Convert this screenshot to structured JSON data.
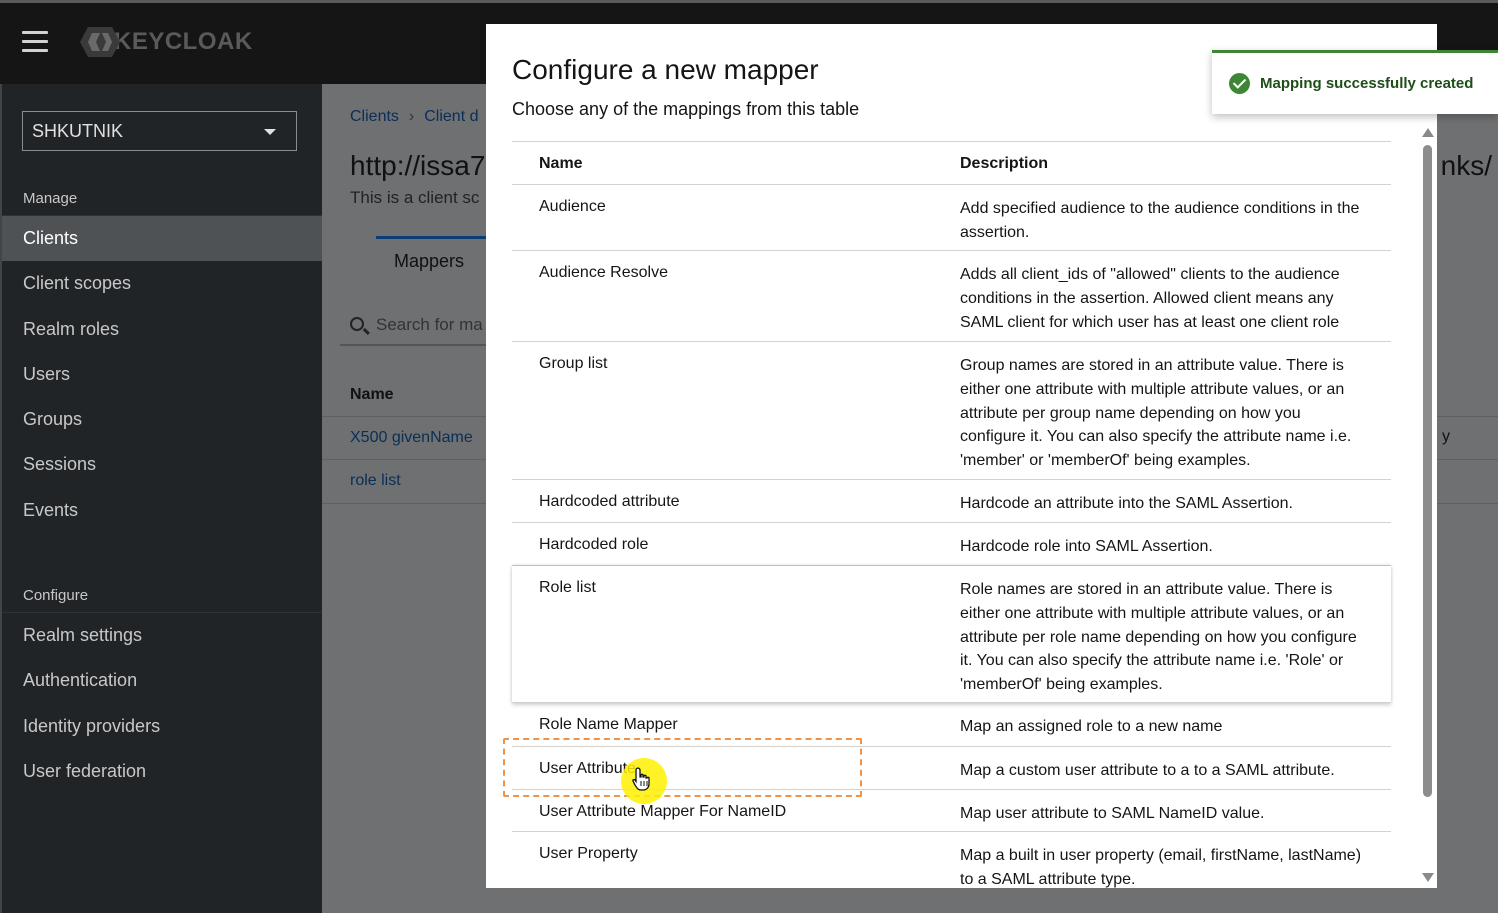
{
  "header": {
    "logo_text": "KEYCLOAK"
  },
  "sidebar": {
    "realm": "SHKUTNIK",
    "manage_title": "Manage",
    "manage_items": [
      "Clients",
      "Client scopes",
      "Realm roles",
      "Users",
      "Groups",
      "Sessions",
      "Events"
    ],
    "active_item": "Clients",
    "configure_title": "Configure",
    "configure_items": [
      "Realm settings",
      "Authentication",
      "Identity providers",
      "User federation"
    ]
  },
  "background_page": {
    "breadcrumb": [
      "Clients",
      "Client d"
    ],
    "title": "http://issa7",
    "title_tail": "nks/",
    "subtitle": "This is a client sc",
    "tab": "Mappers",
    "search_placeholder": "Search for ma",
    "column_name": "Name",
    "rows": [
      "X500 givenName",
      "role list"
    ],
    "row_tail": "y"
  },
  "modal": {
    "title": "Configure a new mapper",
    "subtitle": "Choose any of the mappings from this table",
    "col_name": "Name",
    "col_description": "Description",
    "rows": [
      {
        "name": "Audience",
        "description": "Add specified audience to the audience conditions in the assertion."
      },
      {
        "name": "Audience Resolve",
        "description": "Adds all client_ids of \"allowed\" clients to the audience conditions in the assertion. Allowed client means any SAML client for which user has at least one client role"
      },
      {
        "name": "Group list",
        "description": "Group names are stored in an attribute value. There is either one attribute with multiple attribute values, or an attribute per group name depending on how you configure it. You can also specify the attribute name i.e. 'member' or 'memberOf' being examples."
      },
      {
        "name": "Hardcoded attribute",
        "description": "Hardcode an attribute into the SAML Assertion."
      },
      {
        "name": "Hardcoded role",
        "description": "Hardcode role into SAML Assertion."
      },
      {
        "name": "Role list",
        "description": "Role names are stored in an attribute value. There is either one attribute with multiple attribute values, or an attribute per role name depending on how you configure it. You can also specify the attribute name i.e. 'Role' or 'memberOf' being examples."
      },
      {
        "name": "Role Name Mapper",
        "description": "Map an assigned role to a new name"
      },
      {
        "name": "User Attribute",
        "description": "Map a custom user attribute to a to a SAML attribute."
      },
      {
        "name": "User Attribute Mapper For NameID",
        "description": "Map user attribute to SAML NameID value."
      },
      {
        "name": "User Property",
        "description": "Map a built in user property (email, firstName, lastName) to a SAML attribute type."
      }
    ]
  },
  "toast": {
    "message": "Mapping successfully created",
    "color": "#3e8635"
  },
  "colors": {
    "masthead": "#151515",
    "sidebar": "#212427",
    "active_nav": "#4f5255",
    "highlight": "#f0924a",
    "link": "#0a2e55"
  }
}
